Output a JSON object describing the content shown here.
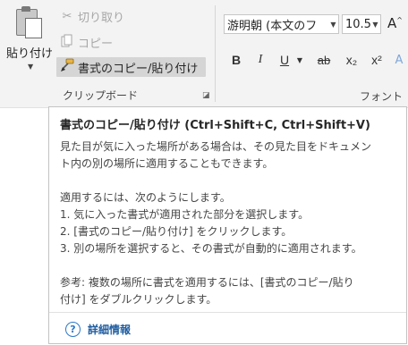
{
  "clipboard": {
    "paste_label": "貼り付け",
    "cut_label": "切り取り",
    "copy_label": "コピー",
    "format_painter_label": "書式のコピー/貼り付け",
    "group_label": "クリップボード"
  },
  "font": {
    "font_name": "游明朝 (本文のフ",
    "font_size": "10.5",
    "group_label": "フォント",
    "superscript": "x²",
    "subscript": "x₂"
  },
  "tooltip": {
    "title": "書式のコピー/貼り付け (Ctrl+Shift+C, Ctrl+Shift+V)",
    "lines": [
      "見た目が気に入った場所がある場合は、その見た目をドキュメン",
      "ト内の別の場所に適用することもできます。",
      "",
      "適用するには、次のようにします。",
      "1. 気に入った書式が適用された部分を選択します。",
      "2. [書式のコピー/貼り付け] をクリックします。",
      "3. 別の場所を選択すると、その書式が自動的に適用されます。",
      "",
      "参考: 複数の場所に書式を適用するには、[書式のコピー/貼り",
      "付け] をダブルクリックします。"
    ],
    "more_info_label": "詳細情報"
  },
  "icons": {
    "cut": "scissors-icon",
    "copy": "copy-icon",
    "format_painter": "paintbrush-icon",
    "help": "help-circle-icon"
  },
  "colors": {
    "ribbon_bg": "#f3f3f3",
    "link": "#1f5da0",
    "help_icon": "#2b78c9",
    "highlight": "#d5d5d5"
  }
}
